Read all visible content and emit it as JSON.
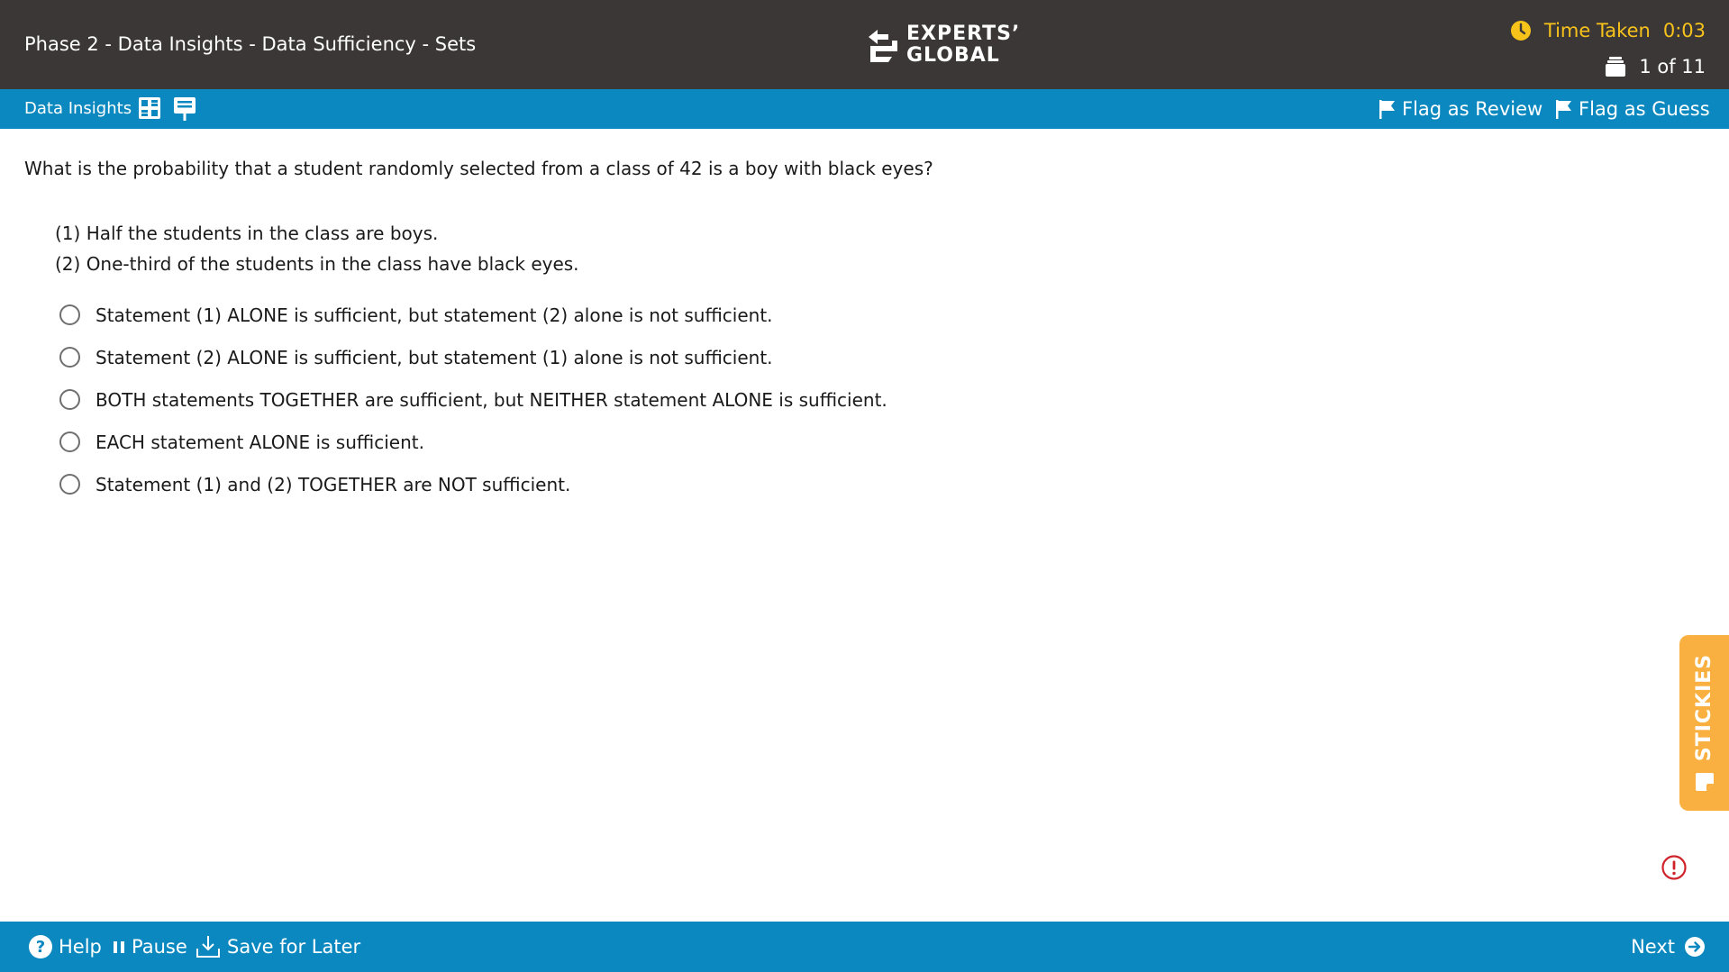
{
  "header": {
    "title": "Phase 2 - Data Insights - Data Sufficiency - Sets",
    "logo_line1": "EXPERTS’",
    "logo_line2": "GLOBAL",
    "timer_label": "Time Taken",
    "timer_value": "0:03",
    "progress": "1 of 11",
    "colors": {
      "background": "#3b3736",
      "timer": "#f7c31b"
    }
  },
  "subbar": {
    "section": "Data Insights",
    "flag_review": "Flag as Review",
    "flag_guess": "Flag as Guess",
    "icons": [
      "grid-icon",
      "whiteboard-icon",
      "flag-icon"
    ],
    "color": "#0b88bf"
  },
  "question": {
    "stem": "What is the probability that a student randomly selected from a class of 42 is a boy with black eyes?",
    "statements": [
      "(1) Half the students in the class are boys.",
      "(2) One-third of the students in the class have black eyes."
    ],
    "options": [
      "Statement (1) ALONE is sufficient, but statement (2) alone is not sufficient.",
      "Statement (2) ALONE is sufficient, but statement (1) alone is not sufficient.",
      "BOTH statements TOGETHER are sufficient, but NEITHER statement ALONE is sufficient.",
      "EACH statement ALONE is sufficient.",
      "Statement (1) and (2) TOGETHER are NOT sufficient."
    ]
  },
  "stickies": {
    "label": "STICKIES",
    "color": "#f9b040"
  },
  "footer": {
    "help": "Help",
    "pause": "Pause",
    "save": "Save for Later",
    "next": "Next"
  }
}
